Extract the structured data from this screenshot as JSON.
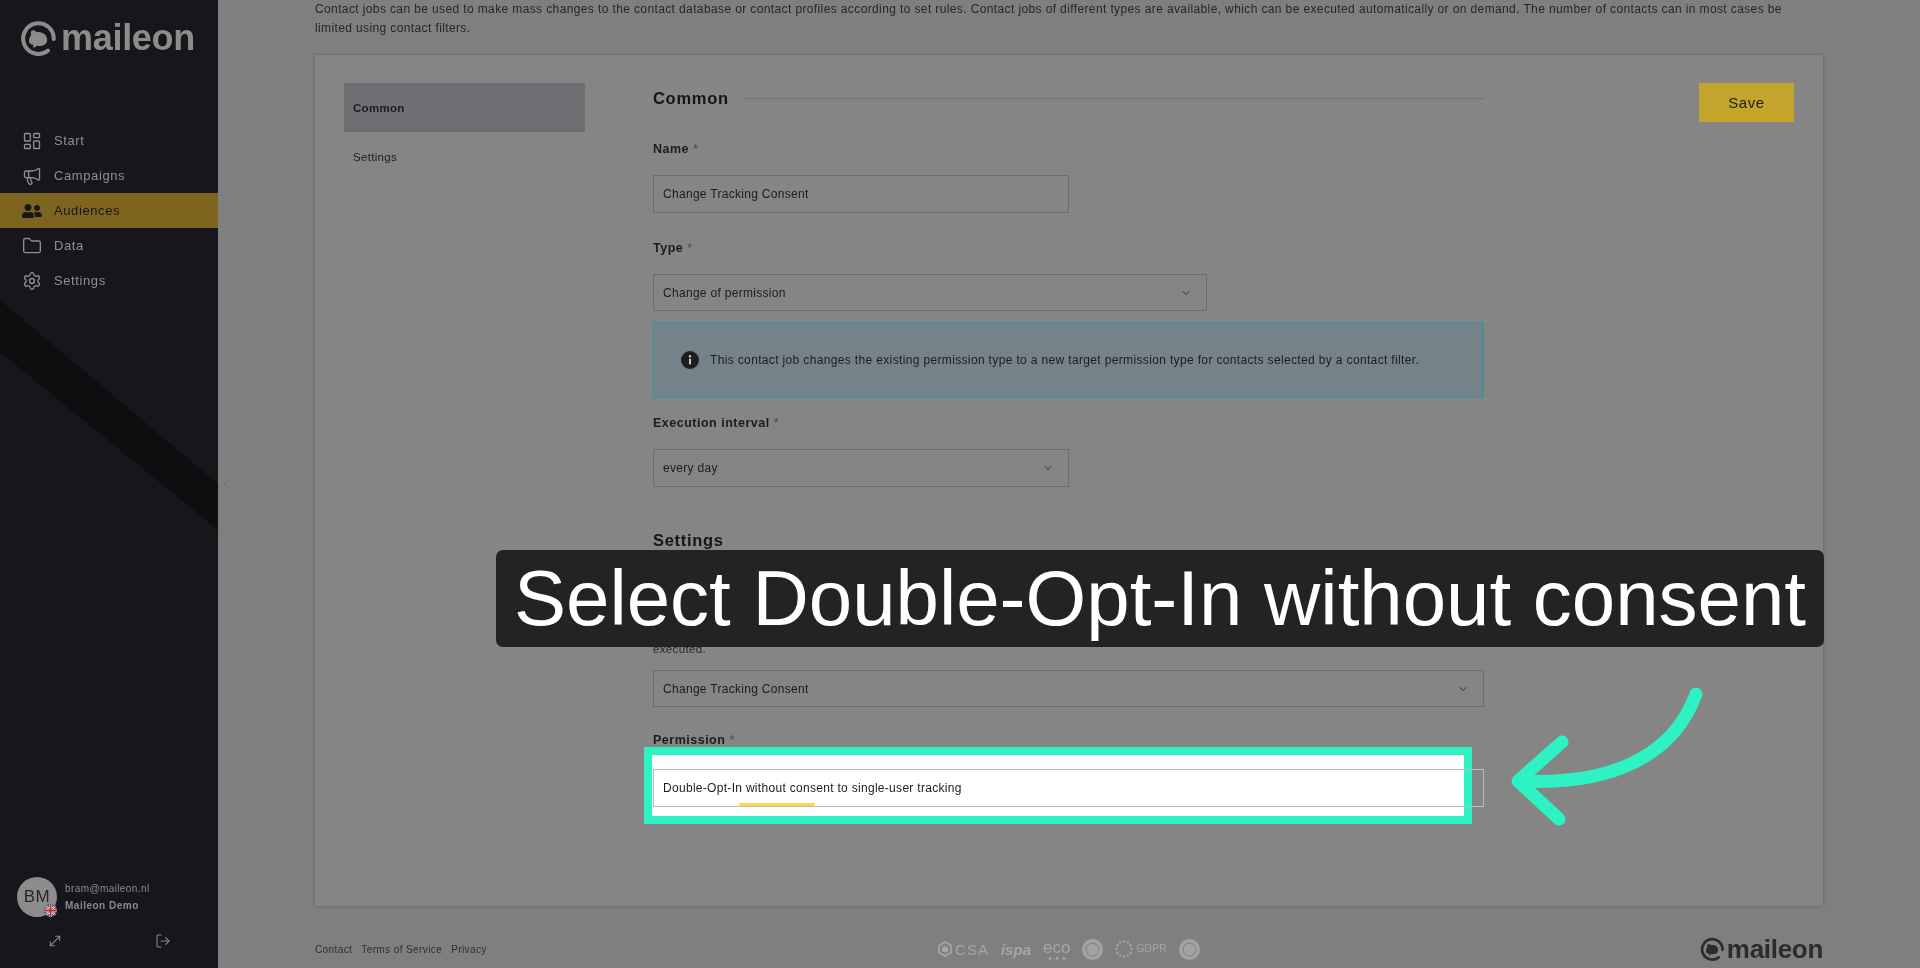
{
  "sidebar": {
    "logo": "maileon",
    "nav": [
      {
        "label": "Start",
        "selected": false
      },
      {
        "label": "Campaigns",
        "selected": false
      },
      {
        "label": "Audiences",
        "selected": true
      },
      {
        "label": "Data",
        "selected": false
      },
      {
        "label": "Settings",
        "selected": false
      }
    ],
    "user": {
      "initials": "BM",
      "email": "bram@maileon.nl",
      "account": "Maileon Demo"
    }
  },
  "intro": "Contact jobs can be used to make mass changes to the contact database or contact profiles according to set rules. Contact jobs of different types are available, which can be executed automatically or on demand. The number of contacts can in most cases be limited using contact filters.",
  "card": {
    "nav": [
      {
        "label": "Common",
        "selected": true
      },
      {
        "label": "Settings",
        "selected": false
      }
    ],
    "save_button": "Save",
    "common": {
      "title": "Common",
      "name": {
        "label": "Name",
        "required_mark": "*",
        "value": "Change Tracking Consent"
      },
      "type": {
        "label": "Type",
        "required_mark": "*",
        "value": "Change of permission"
      },
      "type_info": "This contact job changes the existing permission type to a new target permission type for contacts selected by a contact filter.",
      "interval": {
        "label": "Execution interval",
        "required_mark": "*",
        "value": "every day"
      }
    },
    "settings": {
      "title": "Settings",
      "filter_note_tail": "executed.",
      "filter": {
        "value": "Change Tracking Consent"
      },
      "permission": {
        "label": "Permission",
        "required_mark": "*",
        "value": "Double-Opt-In without consent to single-user tracking"
      }
    }
  },
  "annotation": {
    "caption": "Select Double-Opt-In without consent"
  },
  "footer": {
    "links": [
      "Contact",
      "Terms of Service",
      "Privacy"
    ],
    "badges": [
      {
        "kind": "shield",
        "text": "CSA"
      },
      {
        "kind": "wordmark",
        "text": "ispa"
      },
      {
        "kind": "dotted",
        "text": "eco"
      },
      {
        "kind": "seal"
      },
      {
        "kind": "ring",
        "text": "GDPR"
      },
      {
        "kind": "seal"
      }
    ],
    "logo": "maileon"
  }
}
